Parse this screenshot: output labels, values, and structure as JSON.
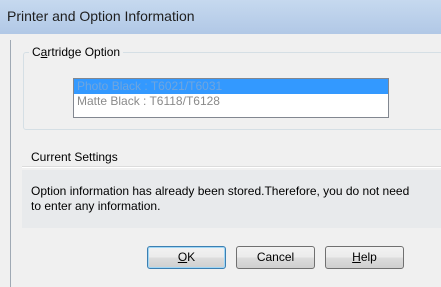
{
  "window": {
    "title": "Printer and Option Information"
  },
  "cartridge_group": {
    "label_mnemonic": "a",
    "label_prefix": "C",
    "label_suffix": "rtridge Option",
    "items": [
      {
        "label": "Photo Black : T6021/T6031",
        "selected": true
      },
      {
        "label": "Matte Black : T6118/T6128",
        "selected": false
      }
    ]
  },
  "current_settings": {
    "label": "Current Settings",
    "message": "Option information has already been stored.Therefore, you do not need to enter any information."
  },
  "buttons": {
    "ok": {
      "mnemonic": "O",
      "rest": "K"
    },
    "cancel": {
      "label": "Cancel"
    },
    "help": {
      "mnemonic": "H",
      "rest": "elp"
    }
  }
}
